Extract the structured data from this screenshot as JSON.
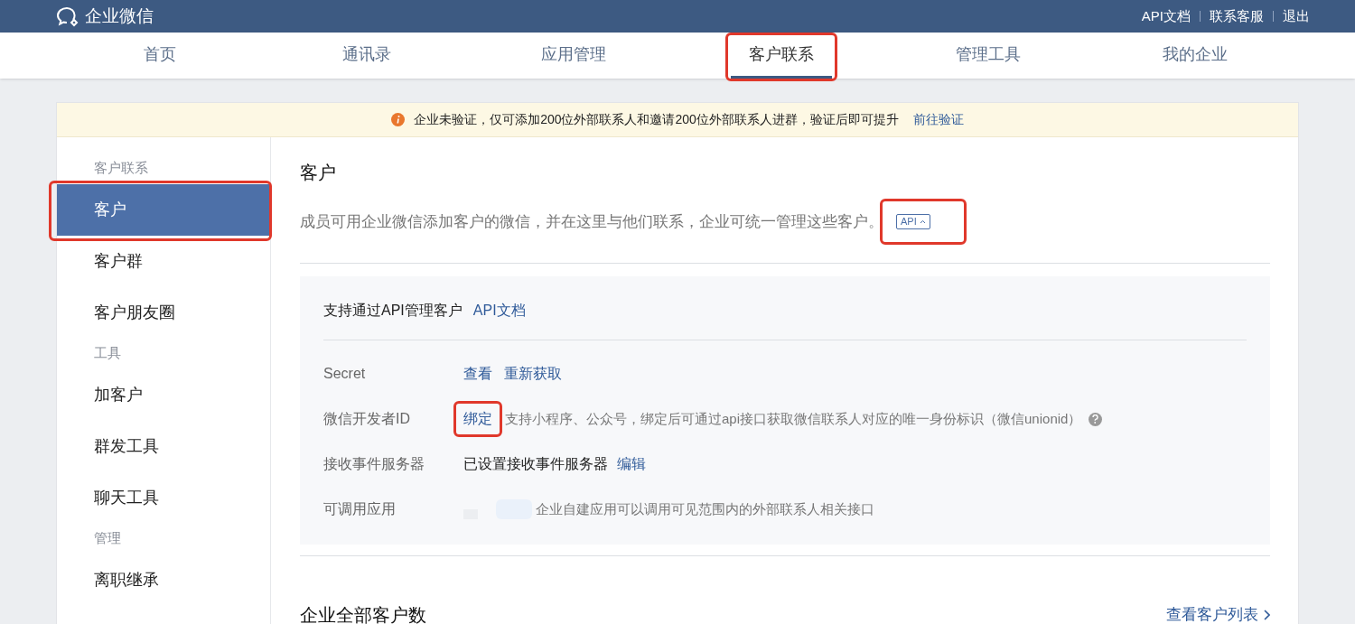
{
  "topbar": {
    "logo": "企业微信",
    "links": [
      "API文档",
      "联系客服",
      "退出"
    ]
  },
  "nav": [
    {
      "label": "首页",
      "selected": false,
      "highlighted": false
    },
    {
      "label": "通讯录",
      "selected": false,
      "highlighted": false
    },
    {
      "label": "应用管理",
      "selected": false,
      "highlighted": false
    },
    {
      "label": "客户联系",
      "selected": true,
      "highlighted": true
    },
    {
      "label": "管理工具",
      "selected": false,
      "highlighted": false
    },
    {
      "label": "我的企业",
      "selected": false,
      "highlighted": false
    }
  ],
  "notice": {
    "text": "企业未验证，仅可添加200位外部联系人和邀请200位外部联系人进群，验证后即可提升",
    "link": "前往验证"
  },
  "sidebar": [
    {
      "heading": "客户联系",
      "items": [
        {
          "label": "客户",
          "selected": true,
          "highlighted": true
        },
        {
          "label": "客户群",
          "selected": false,
          "highlighted": false
        },
        {
          "label": "客户朋友圈",
          "selected": false,
          "highlighted": false
        }
      ]
    },
    {
      "heading": "工具",
      "items": [
        {
          "label": "加客户",
          "selected": false,
          "highlighted": false
        },
        {
          "label": "群发工具",
          "selected": false,
          "highlighted": false
        },
        {
          "label": "聊天工具",
          "selected": false,
          "highlighted": false
        }
      ]
    },
    {
      "heading": "管理",
      "items": [
        {
          "label": "离职继承",
          "selected": false,
          "highlighted": false
        }
      ]
    }
  ],
  "main": {
    "title": "客户",
    "description": "成员可用企业微信添加客户的微信，并在这里与他们联系，企业可统一管理这些客户。",
    "api_badge": {
      "label": "API",
      "highlighted": true
    },
    "api_panel": {
      "title": "支持通过API管理客户",
      "link": "API文档",
      "rows": [
        {
          "kind": "links",
          "label": "Secret",
          "links": [
            {
              "text": "查看",
              "highlighted": false
            },
            {
              "text": "重新获取",
              "highlighted": false
            }
          ]
        },
        {
          "kind": "link_note",
          "label": "微信开发者ID",
          "links": [
            {
              "text": "绑定",
              "highlighted": true
            }
          ],
          "note": "支持小程序、公众号，绑定后可通过api接口获取微信联系人对应的唯一身份标识（微信unionid）"
        },
        {
          "kind": "text_link",
          "label": "接收事件服务器",
          "text": "已设置接收事件服务器",
          "links": [
            {
              "text": "编辑",
              "highlighted": false
            }
          ]
        },
        {
          "kind": "apps",
          "label": "可调用应用",
          "note": "企业自建应用可以调用可见范围内的外部联系人相关接口"
        }
      ]
    },
    "section": {
      "title": "企业全部客户数",
      "link": "查看客户列表"
    }
  }
}
